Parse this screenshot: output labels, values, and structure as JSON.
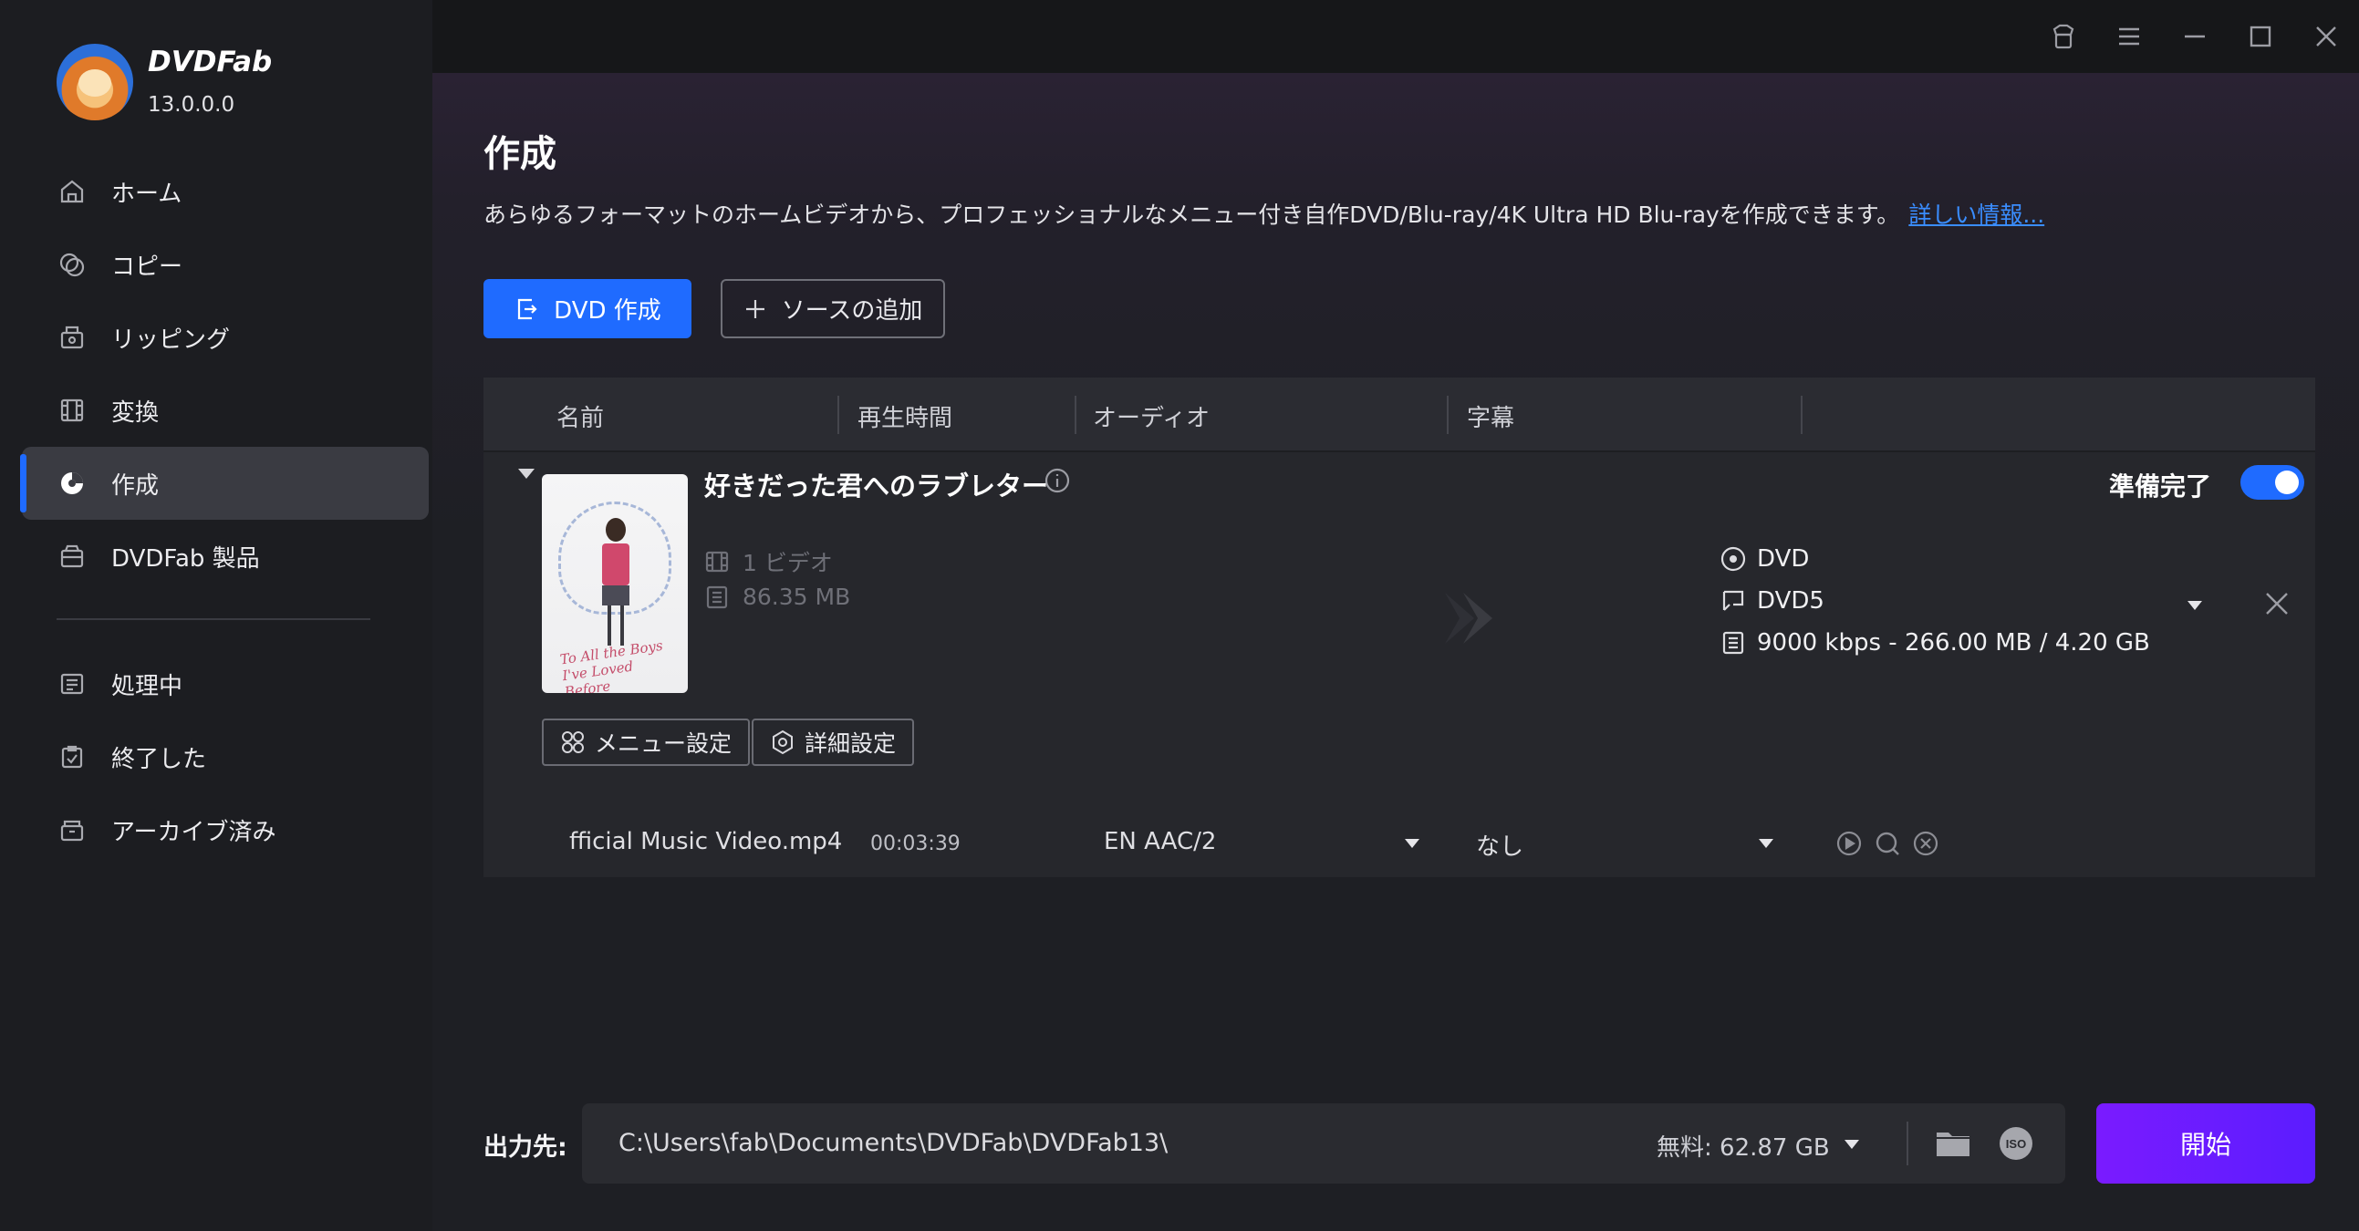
{
  "app": {
    "brand": "DVDFab",
    "version": "13.0.0.0"
  },
  "sidebar": {
    "items": [
      {
        "label": "ホーム",
        "icon": "home-icon"
      },
      {
        "label": "コピー",
        "icon": "copy-icon"
      },
      {
        "label": "リッピング",
        "icon": "ripper-icon"
      },
      {
        "label": "変換",
        "icon": "convert-icon"
      },
      {
        "label": "作成",
        "icon": "creator-icon",
        "active": true
      },
      {
        "label": "DVDFab 製品",
        "icon": "products-icon"
      },
      {
        "label": "処理中",
        "icon": "processing-icon"
      },
      {
        "label": "終了した",
        "icon": "finished-icon"
      },
      {
        "label": "アーカイブ済み",
        "icon": "archive-icon"
      }
    ]
  },
  "titlebar": {
    "icons": [
      "skin-icon",
      "menu-icon",
      "minimize-icon",
      "maximize-icon",
      "close-icon"
    ]
  },
  "main": {
    "title": "作成",
    "description": "あらゆるフォーマットのホームビデオから、プロフェッショナルなメニュー付き自作DVD/Blu-ray/4K Ultra HD Blu-rayを作成できます。",
    "more_link": "詳しい情報...",
    "mode_button": "DVD 作成",
    "add_source_button": "ソースの追加"
  },
  "table": {
    "headers": [
      "名前",
      "再生時間",
      "オーディオ",
      "字幕"
    ],
    "item": {
      "title": "好きだった君へのラブレター",
      "poster_text": "To All the Boys I've Loved Before",
      "video_count": "1 ビデオ",
      "size": "86.35 MB",
      "ready_label": "準備完了",
      "ready": true,
      "output_format": "DVD",
      "disc_type": "DVD5",
      "bitrate_info": "9000 kbps - 266.00 MB / 4.20 GB",
      "menu_button": "メニュー設定",
      "advanced_button": "詳細設定",
      "track": {
        "file": "fficial Music Video.mp4",
        "duration": "00:03:39",
        "audio": "EN  AAC/2",
        "subtitle": "なし"
      }
    }
  },
  "footer": {
    "output_label": "出力先:",
    "path": "C:\\Users\\fab\\Documents\\DVDFab\\DVDFab13\\",
    "free_space": "無料: 62.87 GB",
    "start_button": "開始"
  },
  "colors": {
    "accent": "#1f6bff",
    "start": "#6a1bff",
    "link": "#3a8dff"
  }
}
